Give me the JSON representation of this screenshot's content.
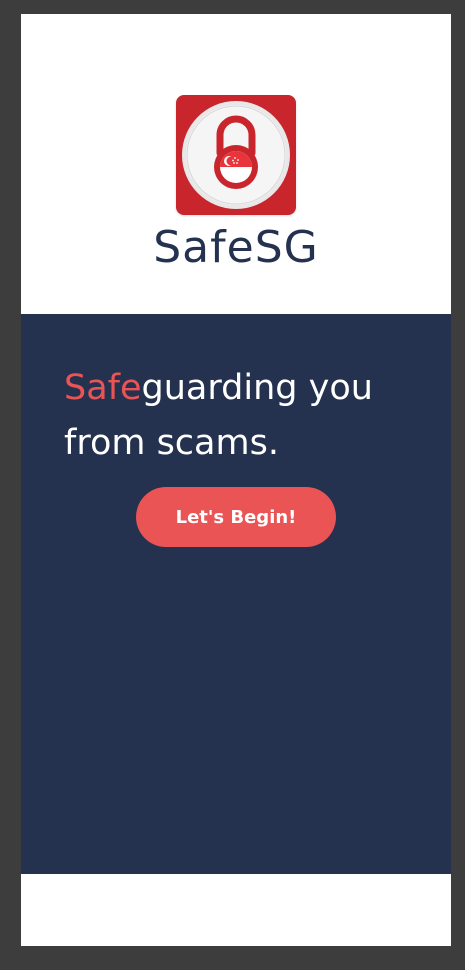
{
  "app": {
    "name": "SafeSG",
    "logo_icon": "padlock-singapore-flag-icon",
    "colors": {
      "navy": "#25324f",
      "accent": "#ea5455",
      "logo_red": "#c9252c",
      "white": "#ffffff"
    }
  },
  "hero": {
    "tagline_accent": "Safe",
    "tagline_rest": "guarding you from scams.",
    "cta_label": "Let's Begin!"
  }
}
